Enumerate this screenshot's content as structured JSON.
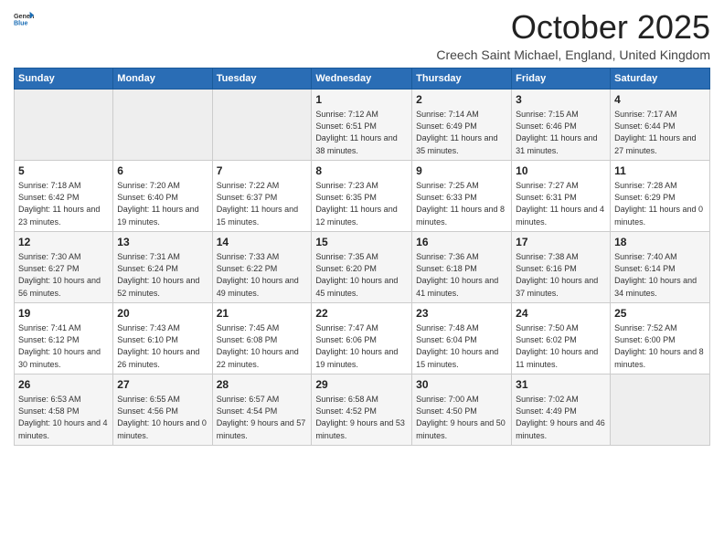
{
  "header": {
    "logo": {
      "general": "General",
      "blue": "Blue"
    },
    "month": "October 2025",
    "location": "Creech Saint Michael, England, United Kingdom"
  },
  "days_of_week": [
    "Sunday",
    "Monday",
    "Tuesday",
    "Wednesday",
    "Thursday",
    "Friday",
    "Saturday"
  ],
  "weeks": [
    [
      {
        "day": "",
        "sunrise": "",
        "sunset": "",
        "daylight": ""
      },
      {
        "day": "",
        "sunrise": "",
        "sunset": "",
        "daylight": ""
      },
      {
        "day": "",
        "sunrise": "",
        "sunset": "",
        "daylight": ""
      },
      {
        "day": "1",
        "sunrise": "Sunrise: 7:12 AM",
        "sunset": "Sunset: 6:51 PM",
        "daylight": "Daylight: 11 hours and 38 minutes."
      },
      {
        "day": "2",
        "sunrise": "Sunrise: 7:14 AM",
        "sunset": "Sunset: 6:49 PM",
        "daylight": "Daylight: 11 hours and 35 minutes."
      },
      {
        "day": "3",
        "sunrise": "Sunrise: 7:15 AM",
        "sunset": "Sunset: 6:46 PM",
        "daylight": "Daylight: 11 hours and 31 minutes."
      },
      {
        "day": "4",
        "sunrise": "Sunrise: 7:17 AM",
        "sunset": "Sunset: 6:44 PM",
        "daylight": "Daylight: 11 hours and 27 minutes."
      }
    ],
    [
      {
        "day": "5",
        "sunrise": "Sunrise: 7:18 AM",
        "sunset": "Sunset: 6:42 PM",
        "daylight": "Daylight: 11 hours and 23 minutes."
      },
      {
        "day": "6",
        "sunrise": "Sunrise: 7:20 AM",
        "sunset": "Sunset: 6:40 PM",
        "daylight": "Daylight: 11 hours and 19 minutes."
      },
      {
        "day": "7",
        "sunrise": "Sunrise: 7:22 AM",
        "sunset": "Sunset: 6:37 PM",
        "daylight": "Daylight: 11 hours and 15 minutes."
      },
      {
        "day": "8",
        "sunrise": "Sunrise: 7:23 AM",
        "sunset": "Sunset: 6:35 PM",
        "daylight": "Daylight: 11 hours and 12 minutes."
      },
      {
        "day": "9",
        "sunrise": "Sunrise: 7:25 AM",
        "sunset": "Sunset: 6:33 PM",
        "daylight": "Daylight: 11 hours and 8 minutes."
      },
      {
        "day": "10",
        "sunrise": "Sunrise: 7:27 AM",
        "sunset": "Sunset: 6:31 PM",
        "daylight": "Daylight: 11 hours and 4 minutes."
      },
      {
        "day": "11",
        "sunrise": "Sunrise: 7:28 AM",
        "sunset": "Sunset: 6:29 PM",
        "daylight": "Daylight: 11 hours and 0 minutes."
      }
    ],
    [
      {
        "day": "12",
        "sunrise": "Sunrise: 7:30 AM",
        "sunset": "Sunset: 6:27 PM",
        "daylight": "Daylight: 10 hours and 56 minutes."
      },
      {
        "day": "13",
        "sunrise": "Sunrise: 7:31 AM",
        "sunset": "Sunset: 6:24 PM",
        "daylight": "Daylight: 10 hours and 52 minutes."
      },
      {
        "day": "14",
        "sunrise": "Sunrise: 7:33 AM",
        "sunset": "Sunset: 6:22 PM",
        "daylight": "Daylight: 10 hours and 49 minutes."
      },
      {
        "day": "15",
        "sunrise": "Sunrise: 7:35 AM",
        "sunset": "Sunset: 6:20 PM",
        "daylight": "Daylight: 10 hours and 45 minutes."
      },
      {
        "day": "16",
        "sunrise": "Sunrise: 7:36 AM",
        "sunset": "Sunset: 6:18 PM",
        "daylight": "Daylight: 10 hours and 41 minutes."
      },
      {
        "day": "17",
        "sunrise": "Sunrise: 7:38 AM",
        "sunset": "Sunset: 6:16 PM",
        "daylight": "Daylight: 10 hours and 37 minutes."
      },
      {
        "day": "18",
        "sunrise": "Sunrise: 7:40 AM",
        "sunset": "Sunset: 6:14 PM",
        "daylight": "Daylight: 10 hours and 34 minutes."
      }
    ],
    [
      {
        "day": "19",
        "sunrise": "Sunrise: 7:41 AM",
        "sunset": "Sunset: 6:12 PM",
        "daylight": "Daylight: 10 hours and 30 minutes."
      },
      {
        "day": "20",
        "sunrise": "Sunrise: 7:43 AM",
        "sunset": "Sunset: 6:10 PM",
        "daylight": "Daylight: 10 hours and 26 minutes."
      },
      {
        "day": "21",
        "sunrise": "Sunrise: 7:45 AM",
        "sunset": "Sunset: 6:08 PM",
        "daylight": "Daylight: 10 hours and 22 minutes."
      },
      {
        "day": "22",
        "sunrise": "Sunrise: 7:47 AM",
        "sunset": "Sunset: 6:06 PM",
        "daylight": "Daylight: 10 hours and 19 minutes."
      },
      {
        "day": "23",
        "sunrise": "Sunrise: 7:48 AM",
        "sunset": "Sunset: 6:04 PM",
        "daylight": "Daylight: 10 hours and 15 minutes."
      },
      {
        "day": "24",
        "sunrise": "Sunrise: 7:50 AM",
        "sunset": "Sunset: 6:02 PM",
        "daylight": "Daylight: 10 hours and 11 minutes."
      },
      {
        "day": "25",
        "sunrise": "Sunrise: 7:52 AM",
        "sunset": "Sunset: 6:00 PM",
        "daylight": "Daylight: 10 hours and 8 minutes."
      }
    ],
    [
      {
        "day": "26",
        "sunrise": "Sunrise: 6:53 AM",
        "sunset": "Sunset: 4:58 PM",
        "daylight": "Daylight: 10 hours and 4 minutes."
      },
      {
        "day": "27",
        "sunrise": "Sunrise: 6:55 AM",
        "sunset": "Sunset: 4:56 PM",
        "daylight": "Daylight: 10 hours and 0 minutes."
      },
      {
        "day": "28",
        "sunrise": "Sunrise: 6:57 AM",
        "sunset": "Sunset: 4:54 PM",
        "daylight": "Daylight: 9 hours and 57 minutes."
      },
      {
        "day": "29",
        "sunrise": "Sunrise: 6:58 AM",
        "sunset": "Sunset: 4:52 PM",
        "daylight": "Daylight: 9 hours and 53 minutes."
      },
      {
        "day": "30",
        "sunrise": "Sunrise: 7:00 AM",
        "sunset": "Sunset: 4:50 PM",
        "daylight": "Daylight: 9 hours and 50 minutes."
      },
      {
        "day": "31",
        "sunrise": "Sunrise: 7:02 AM",
        "sunset": "Sunset: 4:49 PM",
        "daylight": "Daylight: 9 hours and 46 minutes."
      },
      {
        "day": "",
        "sunrise": "",
        "sunset": "",
        "daylight": ""
      }
    ]
  ]
}
